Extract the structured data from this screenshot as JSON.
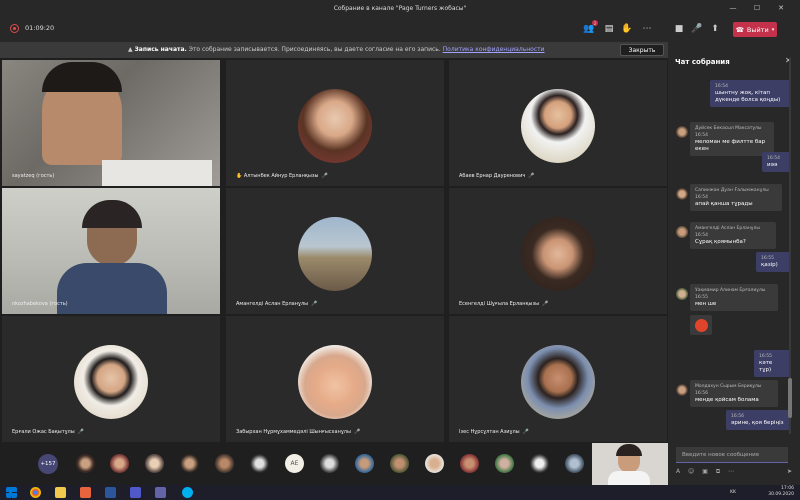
{
  "window": {
    "title": "Собрание в канале \"Page Turners жобасы\""
  },
  "toolbar": {
    "timer": "01:09:20",
    "participants_badge": "2",
    "leave_label": "Выйти",
    "icons": [
      "participants-icon",
      "chat-icon",
      "raise-hand-icon",
      "more-icon",
      "camera-icon",
      "mic-icon",
      "share-icon"
    ]
  },
  "notice": {
    "bold": "Запись начата.",
    "text": "Это собрание записывается. Присоединяясь, вы даете согласие на его запись.",
    "link": "Политика конфиденциальности",
    "close_label": "Закрыть"
  },
  "tiles": [
    {
      "name": "sayatzeq (гость)",
      "kind": "video"
    },
    {
      "name": "Алтынбек Айнур Ерланқызы",
      "kind": "avatar",
      "hand": true
    },
    {
      "name": "Абаев Ернар Дауренович",
      "kind": "avatar"
    },
    {
      "name": "nkozhabekova (гость)",
      "kind": "video"
    },
    {
      "name": "Амангелді Аслан Ерланұлы",
      "kind": "avatar"
    },
    {
      "name": "Есенгелді Шұғыла Ерланқызы",
      "kind": "avatar"
    },
    {
      "name": "Ерғали Ожас Бақытұлы",
      "kind": "avatar"
    },
    {
      "name": "Забырхан Нұрмұхаммедәлі Шынғысханұлы",
      "kind": "avatar"
    },
    {
      "name": "Ізес Нұрсұлтан Азиұлы",
      "kind": "avatar"
    }
  ],
  "strip": {
    "more_count": "+157",
    "initials": "AE"
  },
  "chat": {
    "title": "Чат собрания",
    "messages": [
      {
        "mine": true,
        "time": "16:54",
        "text": "шынтну жоқ, кітап дүкенде болса қоңды)"
      },
      {
        "mine": false,
        "author": "Дүйсек Бекасыл Максатұлы",
        "time": "16:54",
        "text": "меломан ме филтте бар екен"
      },
      {
        "mine": true,
        "time": "16:54",
        "text": "иәә"
      },
      {
        "mine": false,
        "author": "Сапинжан Дуан Ғалымжанұлы",
        "time": "16:54",
        "text": "апай қанша тұрады"
      },
      {
        "mine": false,
        "author": "Амангелді Аслан Ерланұлы",
        "time": "16:54",
        "text": "Сұрақ қоямынба?"
      },
      {
        "mine": true,
        "time": "16:55",
        "text": "қазір)"
      },
      {
        "mine": false,
        "author": "Ұақмамир Алинам Ерғалиұлы",
        "time": "16:55",
        "text": "мен ше"
      },
      {
        "mine": true,
        "time": "16:55",
        "text": "кәте тұр)"
      },
      {
        "mine": false,
        "author": "Молдахун Сырым Бериқұлы",
        "time": "16:56",
        "text": "менде қойсам болама"
      },
      {
        "mine": true,
        "time": "16:56",
        "text": "әрине, қоя беріңіз"
      }
    ],
    "compose_placeholder": "Введите новое сообщение"
  },
  "taskbar": {
    "lang": "KK",
    "time": "17:06",
    "date": "30.09.2020"
  }
}
